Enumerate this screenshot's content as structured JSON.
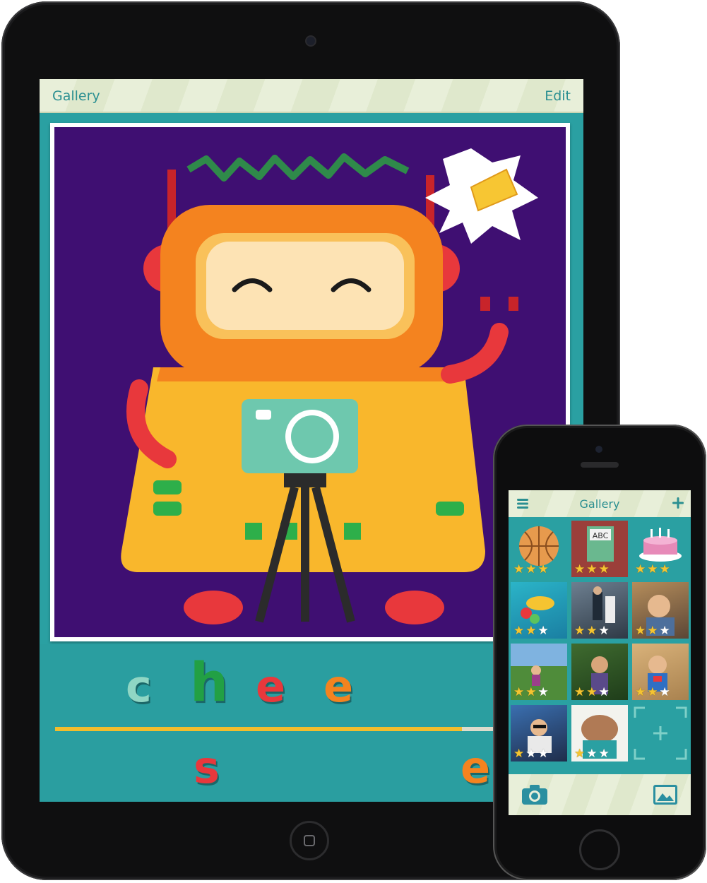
{
  "ipad": {
    "nav": {
      "back_label": "Gallery",
      "edit_label": "Edit"
    },
    "word": {
      "built_letters": [
        "c",
        "h",
        "e",
        "e"
      ],
      "remaining_letters": [
        "s",
        "e"
      ],
      "progress_fraction": 0.77
    }
  },
  "iphone": {
    "nav": {
      "title": "Gallery",
      "menu_icon": "menu-icon",
      "add_icon": "plus-icon"
    },
    "tiles": [
      {
        "name": "basketball",
        "stars": 3
      },
      {
        "name": "abc-book",
        "stars": 3
      },
      {
        "name": "birthday-cake",
        "stars": 3
      },
      {
        "name": "pool-photo",
        "stars": 2
      },
      {
        "name": "wedding-photo",
        "stars": 2
      },
      {
        "name": "boy-photo",
        "stars": 2
      },
      {
        "name": "park-photo",
        "stars": 2
      },
      {
        "name": "garden-photo",
        "stars": 2
      },
      {
        "name": "beach-boy-photo",
        "stars": 2
      },
      {
        "name": "stroller-photo",
        "stars": 1
      },
      {
        "name": "ice-cream-photo",
        "stars": 1
      },
      {
        "name": "add-photo-placeholder",
        "stars": 0
      }
    ],
    "toolbar": {
      "camera_icon": "camera-icon",
      "photos_icon": "photo-library-icon"
    }
  },
  "colors": {
    "teal": "#2aa0a2",
    "nav_bg": "#e8efd9",
    "nav_text": "#2b8f91",
    "photo_bg": "#3f0f72",
    "star": "#f5c431",
    "progress": "#f2bd2c"
  }
}
